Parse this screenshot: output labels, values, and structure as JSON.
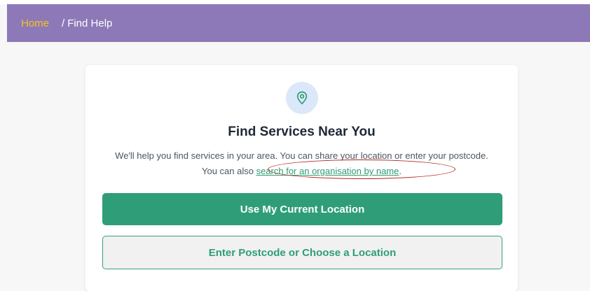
{
  "breadcrumb": {
    "home": "Home",
    "separator": "/",
    "current": "Find Help"
  },
  "card": {
    "icon": "location-pin-icon",
    "title": "Find Services Near You",
    "description_part1": "We'll help you find services in your area. You can share your location or enter your postcode. You can also ",
    "link_text": "search for an organisation by name",
    "description_end": ".",
    "primary_button": "Use My Current Location",
    "secondary_button": "Enter Postcode or Choose a Location"
  },
  "colors": {
    "header": "#8d79b8",
    "home_link": "#f5c518",
    "accent_green": "#2f9e78",
    "annotation_red": "#b3261e",
    "icon_bg": "#dbe8f9"
  }
}
